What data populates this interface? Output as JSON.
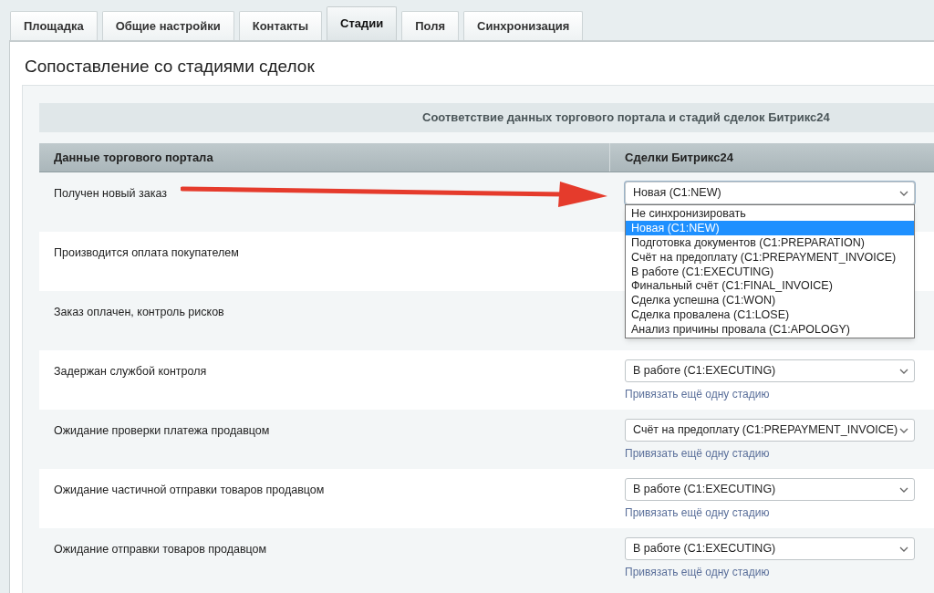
{
  "tabs": [
    {
      "label": "Площадка",
      "selected": false
    },
    {
      "label": "Общие настройки",
      "selected": false
    },
    {
      "label": "Контакты",
      "selected": false
    },
    {
      "label": "Стадии",
      "selected": true
    },
    {
      "label": "Поля",
      "selected": false
    },
    {
      "label": "Синхронизация",
      "selected": false
    }
  ],
  "title": "Сопоставление со стадиями сделок",
  "table": {
    "caption": "Соответствие данных торгового портала и стадий сделок Битрикс24",
    "columns": [
      "Данные торгового портала",
      "Сделки Битрикс24"
    ],
    "rows": [
      {
        "label": "Получен новый заказ",
        "stage": "Новая (C1:NEW)",
        "expanded": true
      },
      {
        "label": "Производится оплата покупателем"
      },
      {
        "label": "Заказ оплачен, контроль рисков"
      },
      {
        "label": "Задержан службой контроля",
        "stage": "В работе (C1:EXECUTING)",
        "link": "Привязать ещё одну стадию"
      },
      {
        "label": "Ожидание проверки платежа продавцом",
        "stage": "Счёт на предоплату (C1:PREPAYMENT_INVOICE)",
        "link": "Привязать ещё одну стадию"
      },
      {
        "label": "Ожидание частичной отправки товаров продавцом",
        "stage": "В работе (C1:EXECUTING)",
        "link": "Привязать ещё одну стадию"
      },
      {
        "label": "Ожидание отправки товаров продавцом",
        "stage": "В работе (C1:EXECUTING)",
        "link": "Привязать ещё одну стадию"
      }
    ]
  },
  "dropdown_options": [
    {
      "label": "Не синхронизировать",
      "selected": false
    },
    {
      "label": "Новая (C1:NEW)",
      "selected": true
    },
    {
      "label": "Подготовка документов (C1:PREPARATION)",
      "selected": false
    },
    {
      "label": "Счёт на предоплату (C1:PREPAYMENT_INVOICE)",
      "selected": false
    },
    {
      "label": "В работе (C1:EXECUTING)",
      "selected": false
    },
    {
      "label": "Финальный счёт (C1:FINAL_INVOICE)",
      "selected": false
    },
    {
      "label": "Сделка успешна (C1:WON)",
      "selected": false
    },
    {
      "label": "Сделка провалена (C1:LOSE)",
      "selected": false
    },
    {
      "label": "Анализ причины провала (C1:APOLOGY)",
      "selected": false
    }
  ]
}
